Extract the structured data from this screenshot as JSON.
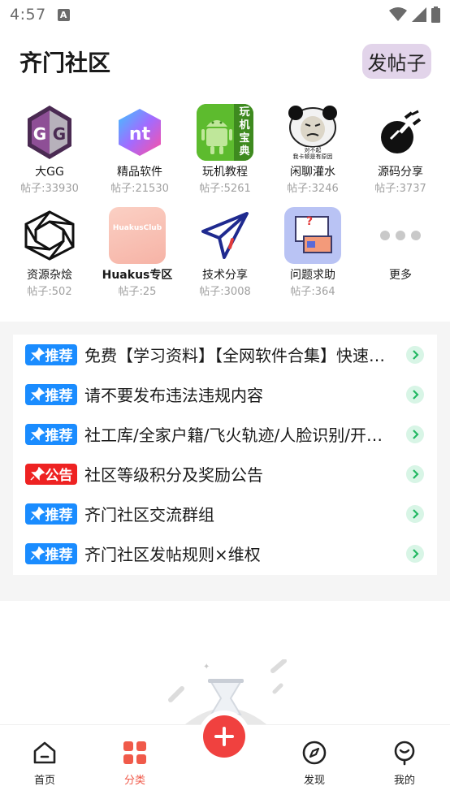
{
  "status_bar": {
    "time": "4:57",
    "notification_glyph": "A"
  },
  "header": {
    "title": "齐门社区",
    "post_button": "发帖子"
  },
  "categories": [
    {
      "name": "大GG",
      "count": "帖子:33930",
      "icon": "gg-logo-icon"
    },
    {
      "name": "精品软件",
      "count": "帖子:21530",
      "icon": "nt-logo-icon"
    },
    {
      "name": "玩机教程",
      "count": "帖子:5261",
      "icon": "android-guide-icon",
      "icon_text": "玩机宝典"
    },
    {
      "name": "闲聊灌水",
      "count": "帖子:3246",
      "icon": "panda-meme-icon",
      "icon_text": "对不起\n我卡顿是有原因"
    },
    {
      "name": "源码分享",
      "count": "帖子:3737",
      "icon": "rocket-code-icon"
    },
    {
      "name": "资源杂烩",
      "count": "帖子:502",
      "icon": "hexagon-knot-icon"
    },
    {
      "name": "Huakus专区",
      "count": "帖子:25",
      "icon": "huakus-club-icon",
      "icon_text": "HuakusClub"
    },
    {
      "name": "技术分享",
      "count": "帖子:3008",
      "icon": "paper-plane-icon"
    },
    {
      "name": "问题求助",
      "count": "帖子:364",
      "icon": "question-board-icon",
      "icon_text": "?"
    },
    {
      "name": "更多",
      "count": "",
      "icon": "more-dots-icon"
    }
  ],
  "notices": [
    {
      "tag": "推荐",
      "tag_color": "#1a8cff",
      "text": "免费【学习资料】【全网软件合集】快速转存"
    },
    {
      "tag": "推荐",
      "tag_color": "#1a8cff",
      "text": "请不要发布违法违规内容"
    },
    {
      "tag": "推荐",
      "tag_color": "#1a8cff",
      "text": "社工库/全家户籍/飞火轨迹/人脸识别/开房记录"
    },
    {
      "tag": "公告",
      "tag_color": "#ee2222",
      "text": "社区等级积分及奖励公告"
    },
    {
      "tag": "推荐",
      "tag_color": "#1a8cff",
      "text": "齐门社区交流群组"
    },
    {
      "tag": "推荐",
      "tag_color": "#1a8cff",
      "text": "齐门社区发帖规则×维权"
    }
  ],
  "bottom_nav": [
    {
      "label": "首页",
      "icon": "home-icon"
    },
    {
      "label": "分类",
      "icon": "category-grid-icon",
      "active": true
    },
    {
      "label": "发现",
      "icon": "compass-icon"
    },
    {
      "label": "我的",
      "icon": "profile-face-icon"
    }
  ],
  "colors": {
    "accent": "#f05a4a",
    "fab": "#f0413f",
    "post_button_bg": "#e2d4ea"
  }
}
